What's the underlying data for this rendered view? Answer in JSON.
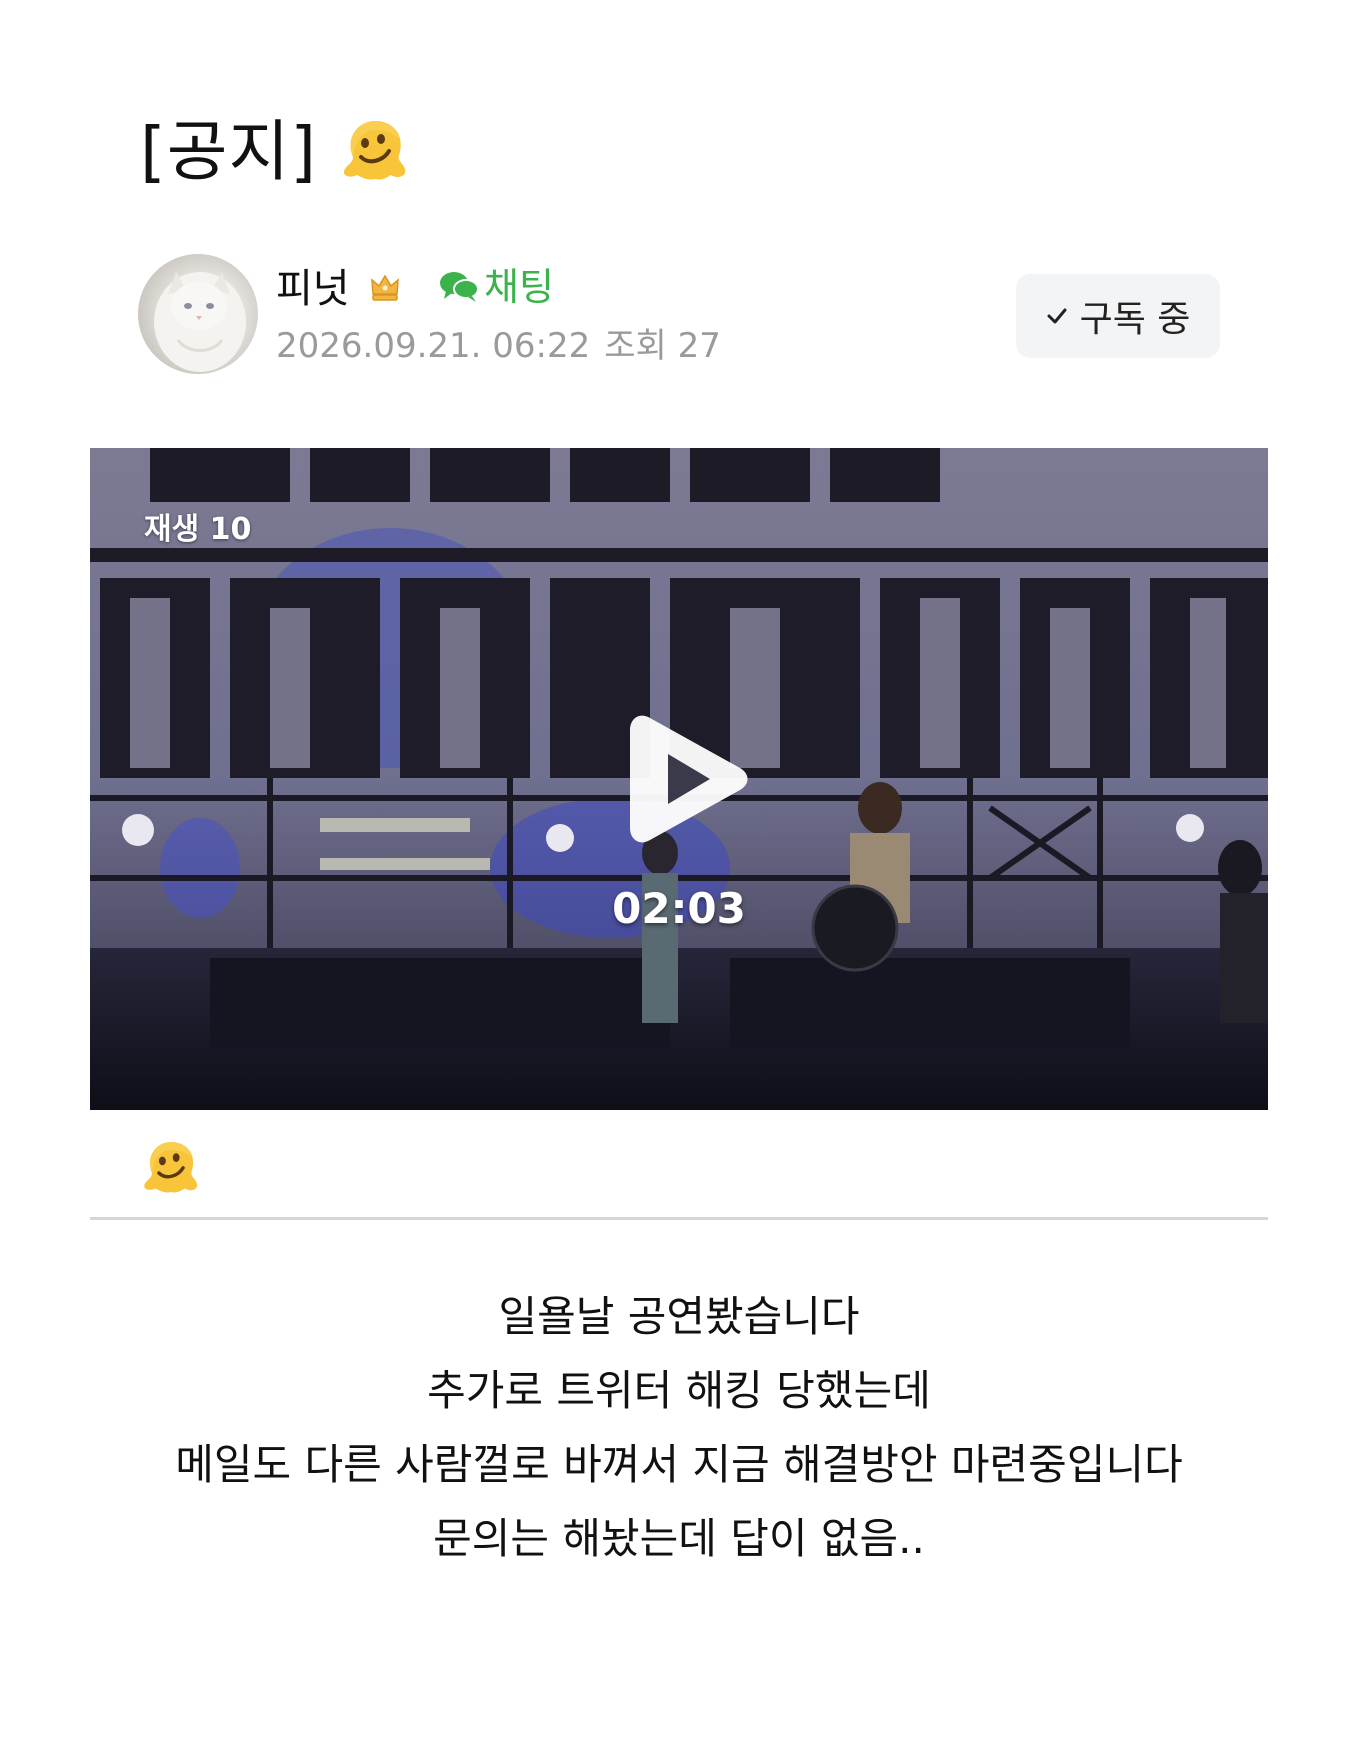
{
  "post": {
    "title": "[공지]",
    "title_emoji": "melting-face-emoji"
  },
  "author": {
    "name": "피넛",
    "badge_icon": "crown-icon",
    "chat_label": "채팅",
    "date": "2026.09.21. 06:22",
    "views_label": "조회 27",
    "subscribe_label": "구독 중"
  },
  "video": {
    "play_count": "재생 10",
    "duration": "02:03"
  },
  "content": {
    "emoji": "melting-face-emoji",
    "lines": [
      "일욜날 공연봤습니다",
      "추가로 트위터 해킹 당했는데",
      "메일도 다른 사람껄로 바껴서 지금 해결방안 마련중입니다",
      "문의는 해놨는데 답이 없음.."
    ]
  },
  "colors": {
    "chat_green": "#3bb34a",
    "meta_gray": "#9a9a9a",
    "button_bg": "#f3f4f6",
    "emoji_yellow": "#f7c43a"
  }
}
